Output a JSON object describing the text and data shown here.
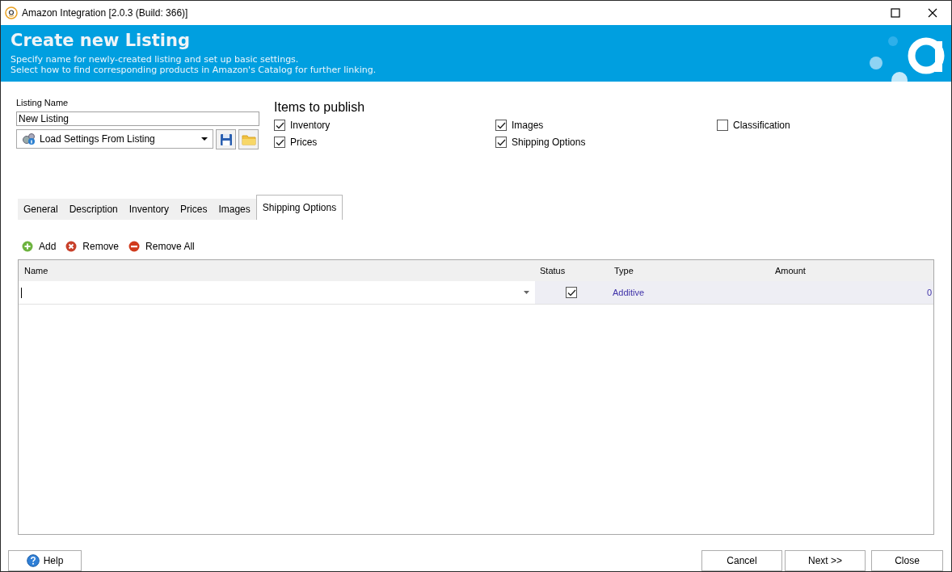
{
  "window": {
    "title": "Amazon Integration [2.0.3 (Build: 366)]"
  },
  "header": {
    "title": "Create new Listing",
    "lines": [
      "Specify name for newly-created listing and set up basic settings.",
      "Select how to find corresponding products in Amazon's Catalog for further linking."
    ]
  },
  "listing_name": {
    "label": "Listing Name",
    "value": "New Listing"
  },
  "load_settings": {
    "value": "Load Settings From Listing"
  },
  "items_to_publish": {
    "title": "Items to publish",
    "items": [
      {
        "label": "Inventory",
        "checked": true
      },
      {
        "label": "Images",
        "checked": true
      },
      {
        "label": "Classification",
        "checked": false
      },
      {
        "label": "Prices",
        "checked": true
      },
      {
        "label": "Shipping Options",
        "checked": true
      }
    ]
  },
  "tabs": [
    {
      "label": "General",
      "selected": false
    },
    {
      "label": "Description",
      "selected": false
    },
    {
      "label": "Inventory",
      "selected": false
    },
    {
      "label": "Prices",
      "selected": false
    },
    {
      "label": "Images",
      "selected": false
    },
    {
      "label": "Shipping Options",
      "selected": true
    }
  ],
  "toolbar": [
    {
      "label": "Add",
      "kind": "add"
    },
    {
      "label": "Remove",
      "kind": "remove"
    },
    {
      "label": "Remove All",
      "kind": "remove_all"
    }
  ],
  "table": {
    "columns": [
      "Name",
      "Status",
      "Type",
      "Amount"
    ],
    "rows": [
      {
        "checked": true,
        "type": "Additive",
        "amount": "0"
      }
    ]
  },
  "buttons": {
    "left": [
      {
        "label": "Help",
        "kind": "help"
      }
    ],
    "right": [
      {
        "label": "Cancel"
      },
      {
        "label": "Next >>"
      },
      {
        "label": "Close"
      }
    ]
  }
}
